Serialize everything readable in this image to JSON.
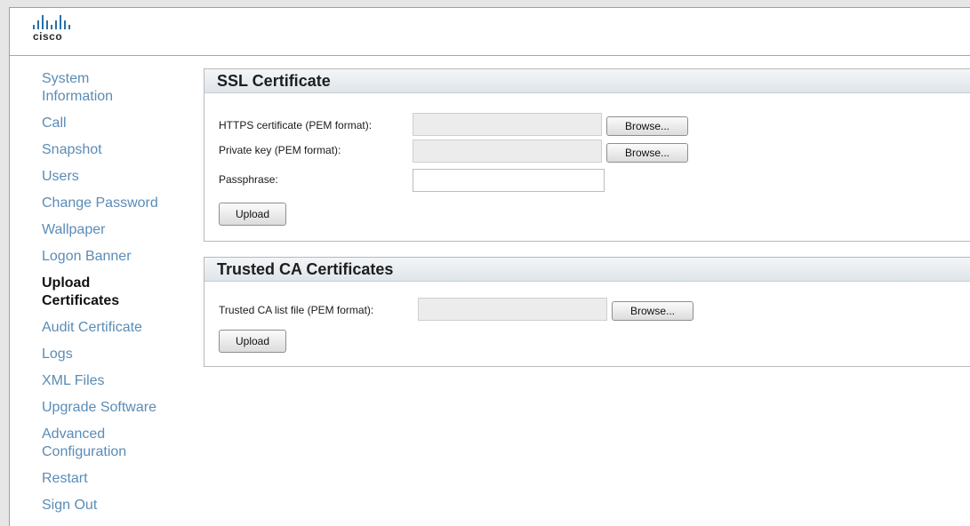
{
  "brand": {
    "logo_text": "cisco"
  },
  "sidebar": {
    "items": [
      {
        "label": "System Information"
      },
      {
        "label": "Call"
      },
      {
        "label": "Snapshot"
      },
      {
        "label": "Users"
      },
      {
        "label": "Change Password"
      },
      {
        "label": "Wallpaper"
      },
      {
        "label": "Logon Banner"
      },
      {
        "label": "Upload Certificates",
        "active": true
      },
      {
        "label": "Audit Certificate"
      },
      {
        "label": "Logs"
      },
      {
        "label": "XML Files"
      },
      {
        "label": "Upgrade Software"
      },
      {
        "label": "Advanced Configuration"
      },
      {
        "label": "Restart"
      },
      {
        "label": "Sign Out"
      }
    ]
  },
  "ssl_panel": {
    "title": "SSL Certificate",
    "https_label": "HTTPS certificate (PEM format):",
    "key_label": "Private key (PEM format):",
    "passphrase_label": "Passphrase:",
    "browse_label": "Browse...",
    "upload_label": "Upload"
  },
  "ca_panel": {
    "title": "Trusted CA Certificates",
    "ca_label": "Trusted CA list file (PEM format):",
    "browse_label": "Browse...",
    "upload_label": "Upload"
  },
  "colors": {
    "nav_link": "#5a8cb6",
    "nav_active": "#111111",
    "panel_header": "#dfe5ea"
  }
}
